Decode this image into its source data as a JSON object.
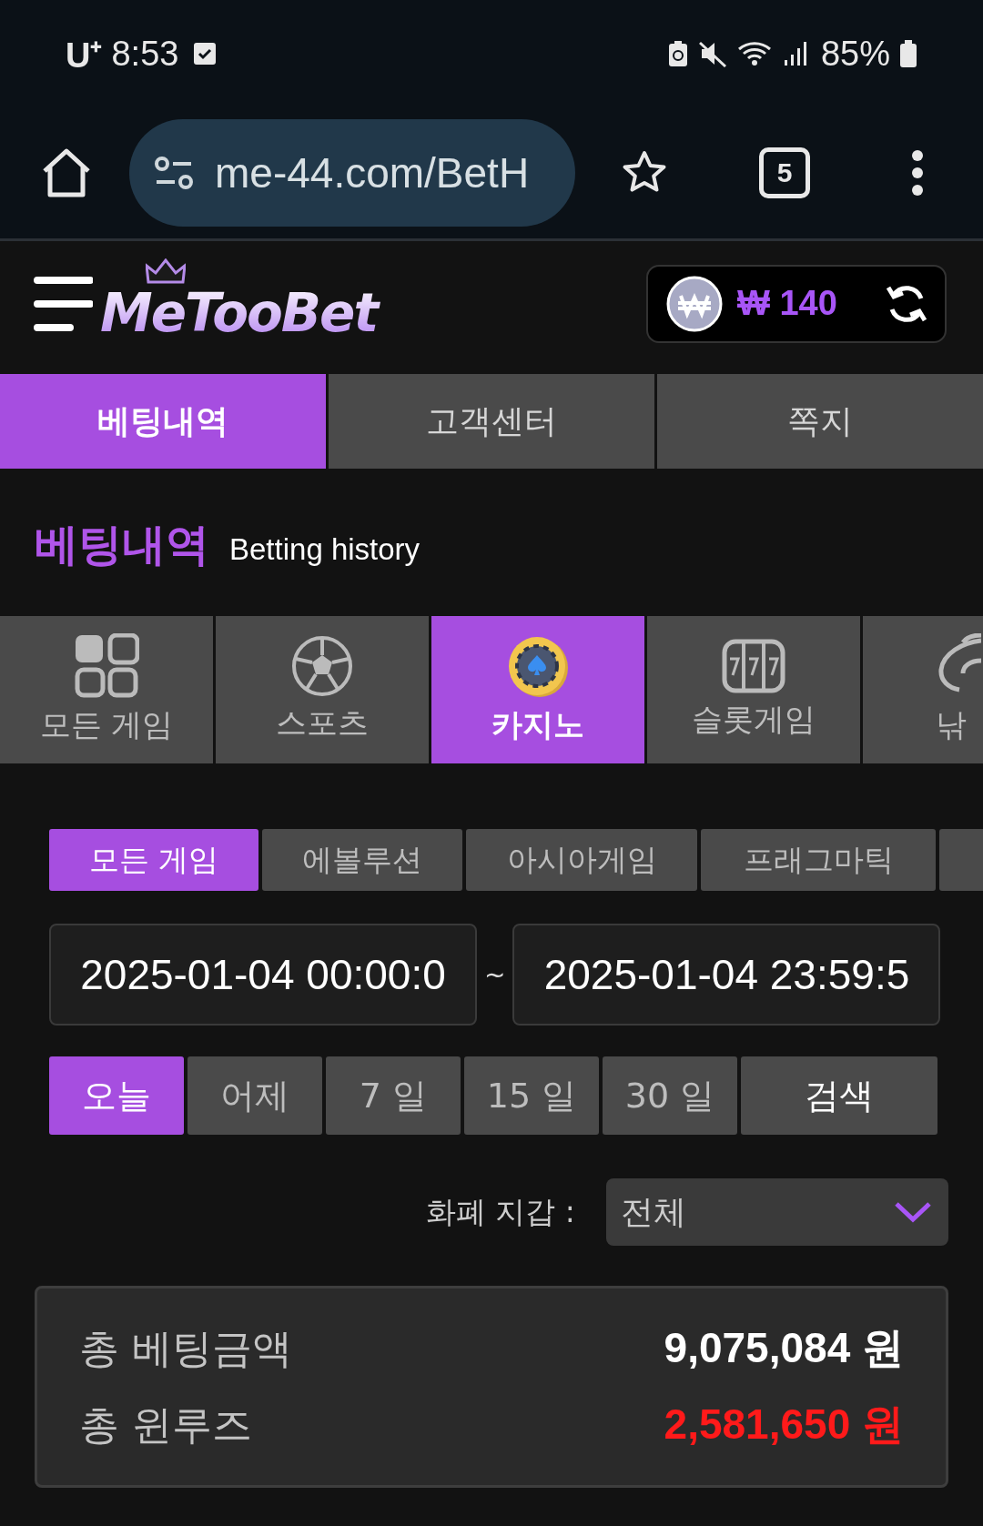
{
  "status_bar": {
    "carrier": "U⁺",
    "time": "8:53",
    "battery": "85%"
  },
  "browser": {
    "url": "me-44.com/BetH",
    "tab_count": "5"
  },
  "header": {
    "logo": "MeTooBet",
    "balance": "₩ 140"
  },
  "main_tabs": [
    {
      "label": "베팅내역",
      "selected": true
    },
    {
      "label": "고객센터",
      "selected": false
    },
    {
      "label": "쪽지",
      "selected": false
    }
  ],
  "page_title": {
    "korean": "베팅내역",
    "english": "Betting history"
  },
  "categories": [
    {
      "label": "모든 게임",
      "kind": "grid",
      "selected": false
    },
    {
      "label": "스포츠",
      "kind": "ball",
      "selected": false
    },
    {
      "label": "카지노",
      "kind": "chip",
      "selected": true
    },
    {
      "label": "슬롯게임",
      "kind": "slot",
      "selected": false
    },
    {
      "label": "낚",
      "kind": "fish",
      "selected": false
    }
  ],
  "providers": [
    {
      "label": "모든 게임",
      "selected": true
    },
    {
      "label": "에볼루션",
      "selected": false
    },
    {
      "label": "아시아게임",
      "selected": false
    },
    {
      "label": "프래그마틱",
      "selected": false
    }
  ],
  "date_range": {
    "start": "2025-01-04 00:00:0",
    "separator": "~",
    "end": "2025-01-04 23:59:5"
  },
  "periods": [
    {
      "label": "오늘",
      "selected": true
    },
    {
      "label": "어제",
      "selected": false
    },
    {
      "label": "7 일",
      "selected": false
    },
    {
      "label": "15 일",
      "selected": false
    },
    {
      "label": "30 일",
      "selected": false
    }
  ],
  "search_button": "검색",
  "wallet": {
    "label": "화폐 지갑 :",
    "value": "전체"
  },
  "summary": [
    {
      "label": "총 베팅금액",
      "value": "9,075,084 원",
      "kind": "neutral"
    },
    {
      "label": "총 윈루즈",
      "value": "2,581,650 원",
      "kind": "negative"
    }
  ]
}
